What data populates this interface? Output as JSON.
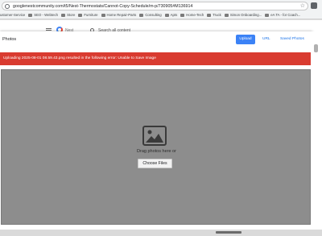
{
  "browser": {
    "url": "googlenestcommunity.com/t5/Nest-Thermostats/Cannot-Copy-Schedule/m-p/730905#M136914",
    "bookmarks": [
      "ustomer-Service",
      "SEO - Webtech",
      "Store",
      "Furniture",
      "Home Repair-Parts",
      "Consulting",
      "Apts",
      "Home-Tech",
      "Truck",
      "Simon Onboarding...",
      "eA TA - for Coach..."
    ]
  },
  "site_header": {
    "logo_text": "Nest",
    "search_placeholder": "Search all content"
  },
  "modal": {
    "title": "Photos",
    "tabs": {
      "upload": "Upload",
      "url": "URL",
      "saved": "Saved Photos"
    },
    "error": "Uploading 2025-08-01 08.59.43.png resulted in the following error: Unable to Save Image",
    "dropzone": {
      "drag_text": "Drag photos here or",
      "choose_label": "Choose Files"
    }
  },
  "colors": {
    "error": "#d93b30",
    "primary": "#3b82f6",
    "dropzone": "#8d8d8d"
  }
}
